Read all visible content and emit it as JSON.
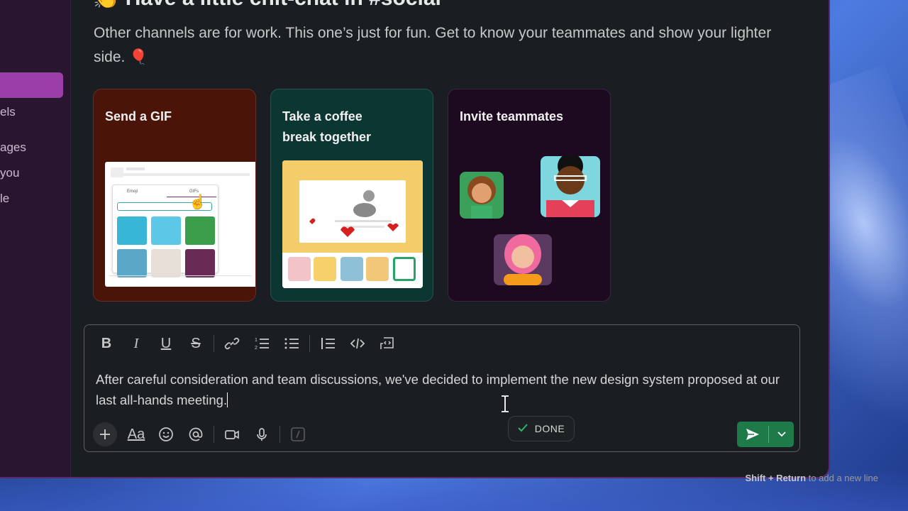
{
  "channel": {
    "title": "👏 Have a little chit-chat in #social",
    "description": "Other channels are for work. This one’s just for fun. Get to know your teammates and show your lighter side. 🎈"
  },
  "sidebar": {
    "items": [
      "els",
      "ages",
      "you",
      "le"
    ]
  },
  "cards": [
    {
      "title": "Send a GIF"
    },
    {
      "title": "Take a coffee break together"
    },
    {
      "title": "Invite teammates"
    }
  ],
  "gif_popup": {
    "tab_emoji": "Emoji",
    "tab_gifs": "GIFs"
  },
  "composer": {
    "text": "After careful consideration and team discussions, we've decided to implement the new design system proposed at our last all-hands meeting.",
    "format_label": "Aa"
  },
  "done_pill": {
    "label": "DONE"
  },
  "hint": {
    "keys": "Shift + Return",
    "text": "to add a new line"
  },
  "colors": {
    "accent": "#9a3fa8",
    "send": "#1f7a4a",
    "done_check": "#2fb36e"
  }
}
